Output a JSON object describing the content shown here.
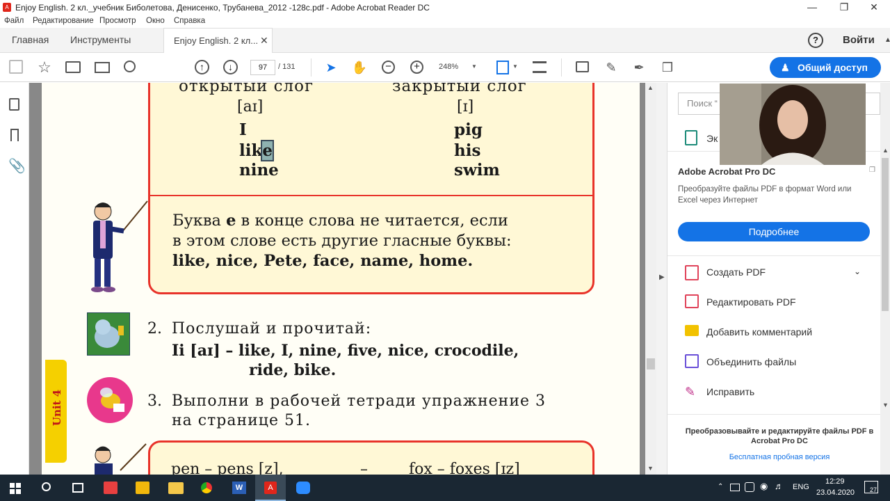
{
  "window": {
    "title": "Enjoy English. 2 кл._учебник Биболетова, Денисенко, Трубанева_2012 -128с.pdf - Adobe Acrobat Reader DC"
  },
  "menu": [
    "Файл",
    "Редактирование",
    "Просмотр",
    "Окно",
    "Справка"
  ],
  "tabs": {
    "home": "Главная",
    "tools": "Инструменты",
    "doc": "Enjoy English. 2 кл...",
    "signin": "Войти"
  },
  "toolbar": {
    "page_current": "97",
    "page_total": "/ 131",
    "zoom": "248%",
    "share": "Общий доступ"
  },
  "search": {
    "placeholder": "Поиск “"
  },
  "rightpane": {
    "export_label": "Эк",
    "promo_title": "Adobe Acrobat Pro DC",
    "promo_text": "Преобразуйте файлы PDF в формат Word или Excel через Интернет",
    "promo_button": "Подробнее",
    "tools": [
      "Создать PDF",
      "Редактировать PDF",
      "Добавить комментарий",
      "Объединить файлы",
      "Исправить"
    ],
    "footer_text": "Преобразовывайте и редактируйте файлы PDF в Acrobat Pro DC",
    "footer_link": "Бесплатная пробная версия"
  },
  "pdf": {
    "head_left": "открытый слог",
    "head_right": "закрытый слог",
    "ipa_left": "[aɪ]",
    "ipa_right": "[ɪ]",
    "words_left": [
      "I",
      "lik",
      "e",
      "nine"
    ],
    "words_right": [
      "pig",
      "his",
      "swim"
    ],
    "rule_line1_a": "Буква ",
    "rule_line1_b": "e",
    "rule_line1_c": " в конце слова не читается, если",
    "rule_line2": "в этом слове есть другие гласные буквы:",
    "rule_line3": "like, nice, Pete, face, name, home.",
    "ex2_num": "2.",
    "ex2_title": "Послушай и прочитай:",
    "ex2_line1": "Ii [aɪ] – like, I, nine, five, nice, crocodile,",
    "ex2_line2": "ride, bike.",
    "ex3_num": "3.",
    "ex3_line1": "Выполни в рабочей тетради упражнение 3",
    "ex3_line2": "на странице 51.",
    "unit": "Unit 4",
    "bottom_left": "pen – pens [z],",
    "bottom_dash": "–",
    "bottom_right": "fox – foxes [ɪz]"
  },
  "taskbar": {
    "lang": "ENG",
    "time": "12:29",
    "date": "23.04.2020",
    "notif": "27"
  }
}
